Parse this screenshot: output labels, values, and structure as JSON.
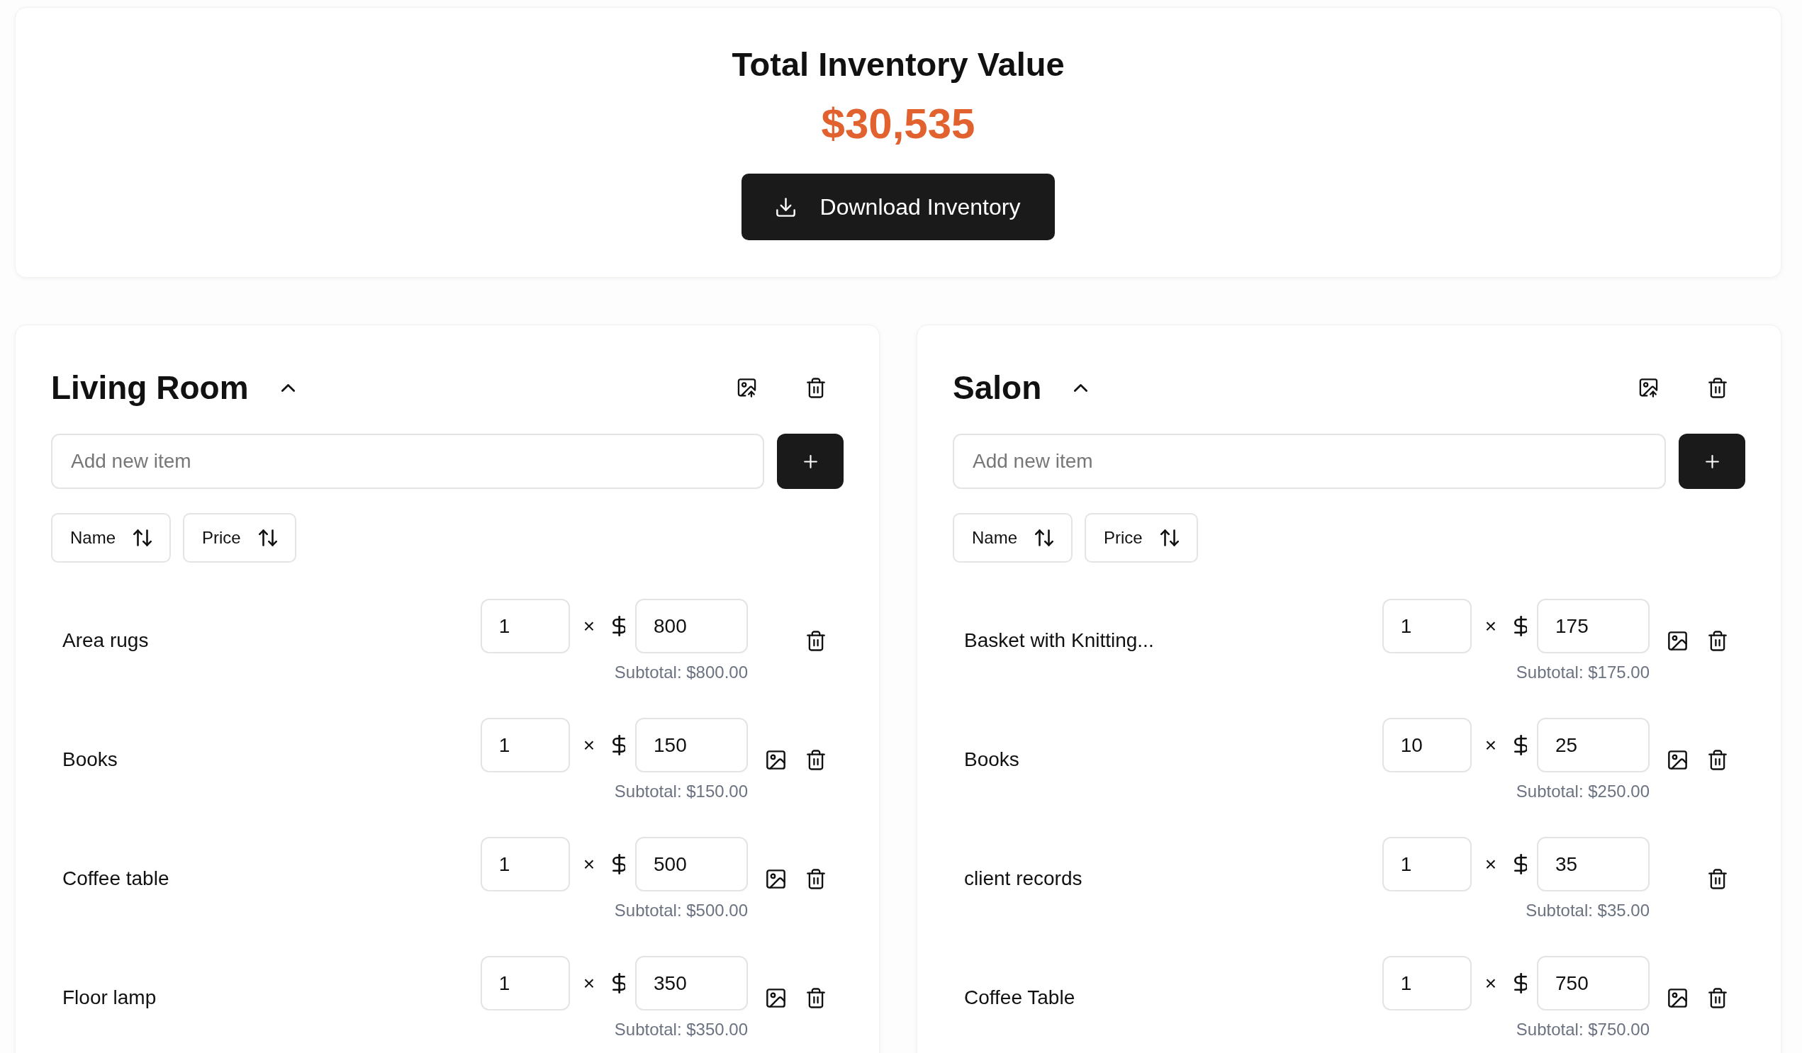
{
  "summary": {
    "title": "Total Inventory Value",
    "amount": "$30,535",
    "button": "Download Inventory"
  },
  "rooms": [
    {
      "name": "Living Room",
      "expanded": true,
      "new_item": {
        "placeholder": "Add new item"
      },
      "sort_buttons": [
        "Name",
        "Price"
      ],
      "items": [
        {
          "name": "Area rugs",
          "quantity": "1",
          "times": "×",
          "price": "800",
          "subtotal": "Subtotal: $800.00",
          "has_photo": false
        },
        {
          "name": "Books",
          "quantity": "1",
          "times": "×",
          "price": "150",
          "subtotal": "Subtotal: $150.00",
          "has_photo": true
        },
        {
          "name": "Coffee table",
          "quantity": "1",
          "times": "×",
          "price": "500",
          "subtotal": "Subtotal: $500.00",
          "has_photo": true
        },
        {
          "name": "Floor lamp",
          "quantity": "1",
          "times": "×",
          "price": "350",
          "subtotal": "Subtotal: $350.00",
          "has_photo": true
        }
      ]
    },
    {
      "name": "Salon",
      "expanded": true,
      "new_item": {
        "placeholder": "Add new item"
      },
      "sort_buttons": [
        "Name",
        "Price"
      ],
      "items": [
        {
          "name": "Basket with Knitting...",
          "quantity": "1",
          "times": "×",
          "price": "175",
          "subtotal": "Subtotal: $175.00",
          "has_photo": true
        },
        {
          "name": "Books",
          "quantity": "10",
          "times": "×",
          "price": "25",
          "subtotal": "Subtotal: $250.00",
          "has_photo": true
        },
        {
          "name": "client records",
          "quantity": "1",
          "times": "×",
          "price": "35",
          "subtotal": "Subtotal: $35.00",
          "has_photo": false
        },
        {
          "name": "Coffee Table",
          "quantity": "1",
          "times": "×",
          "price": "750",
          "subtotal": "Subtotal: $750.00",
          "has_photo": true
        }
      ]
    }
  ]
}
